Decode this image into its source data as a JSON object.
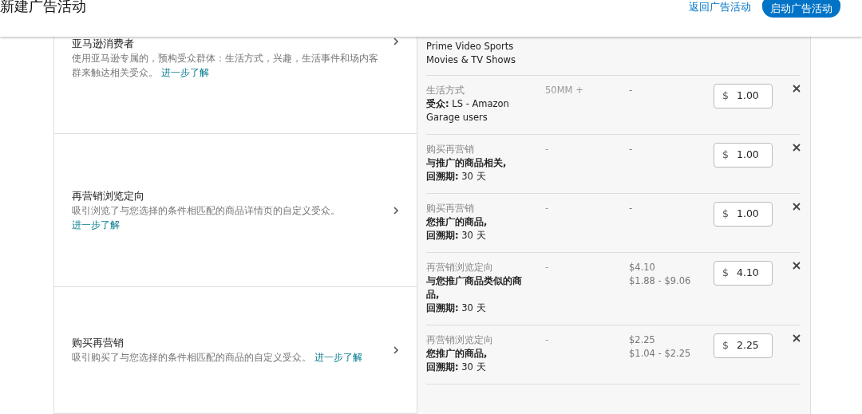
{
  "header": {
    "title": "新建广告活动",
    "back_link": "返回广告活动",
    "launch_button": "启动广告活动"
  },
  "categories": [
    {
      "title": "亚马逊消费者",
      "description": "使用亚马逊专属的，预构受众群体：生活方式，兴趣，生活事件和场内客群来触达相关受众。",
      "link": "进一步了解"
    },
    {
      "title": "再营销浏览定向",
      "description": "吸引浏览了与您选择的条件相匹配的商品详情页的自定义受众。",
      "link": "进一步了解"
    },
    {
      "title": "购买再营销",
      "description": "吸引购买了与您选择的条件相匹配的商品的自定义受众。",
      "link": "进一步了解"
    }
  ],
  "partial_row": {
    "lines": [
      "Prime Video Sports",
      "Movies & TV Shows"
    ]
  },
  "targets": [
    {
      "type": "生活方式",
      "details": [
        "**受众:** LS - Amazon Garage users"
      ],
      "reach": "50MM +",
      "suggested": [
        "-"
      ],
      "bid": {
        "currency": "$",
        "value": "1.00"
      }
    },
    {
      "type": "购买再营销",
      "details": [
        "**与推广的商品相关,**",
        "**回溯期:** 30 天"
      ],
      "reach": "-",
      "suggested": [
        "-"
      ],
      "bid": {
        "currency": "$",
        "value": "1.00"
      }
    },
    {
      "type": "购买再营销",
      "details": [
        "**您推广的商品,**",
        "**回溯期:** 30 天"
      ],
      "reach": "-",
      "suggested": [
        "-"
      ],
      "bid": {
        "currency": "$",
        "value": "1.00"
      }
    },
    {
      "type": "再营销浏览定向",
      "details": [
        "**与您推广商品类似的商品,**",
        "**回溯期:** 30 天"
      ],
      "reach": "-",
      "suggested": [
        "$4.10",
        "$1.88 - $9.06"
      ],
      "bid": {
        "currency": "$",
        "value": "4.10"
      }
    },
    {
      "type": "再营销浏览定向",
      "details": [
        "**您推广的商品,**",
        "**回溯期:** 30 天"
      ],
      "reach": "-",
      "suggested": [
        "$2.25",
        "$1.04 - $2.25"
      ],
      "bid": {
        "currency": "$",
        "value": "2.25"
      }
    }
  ]
}
